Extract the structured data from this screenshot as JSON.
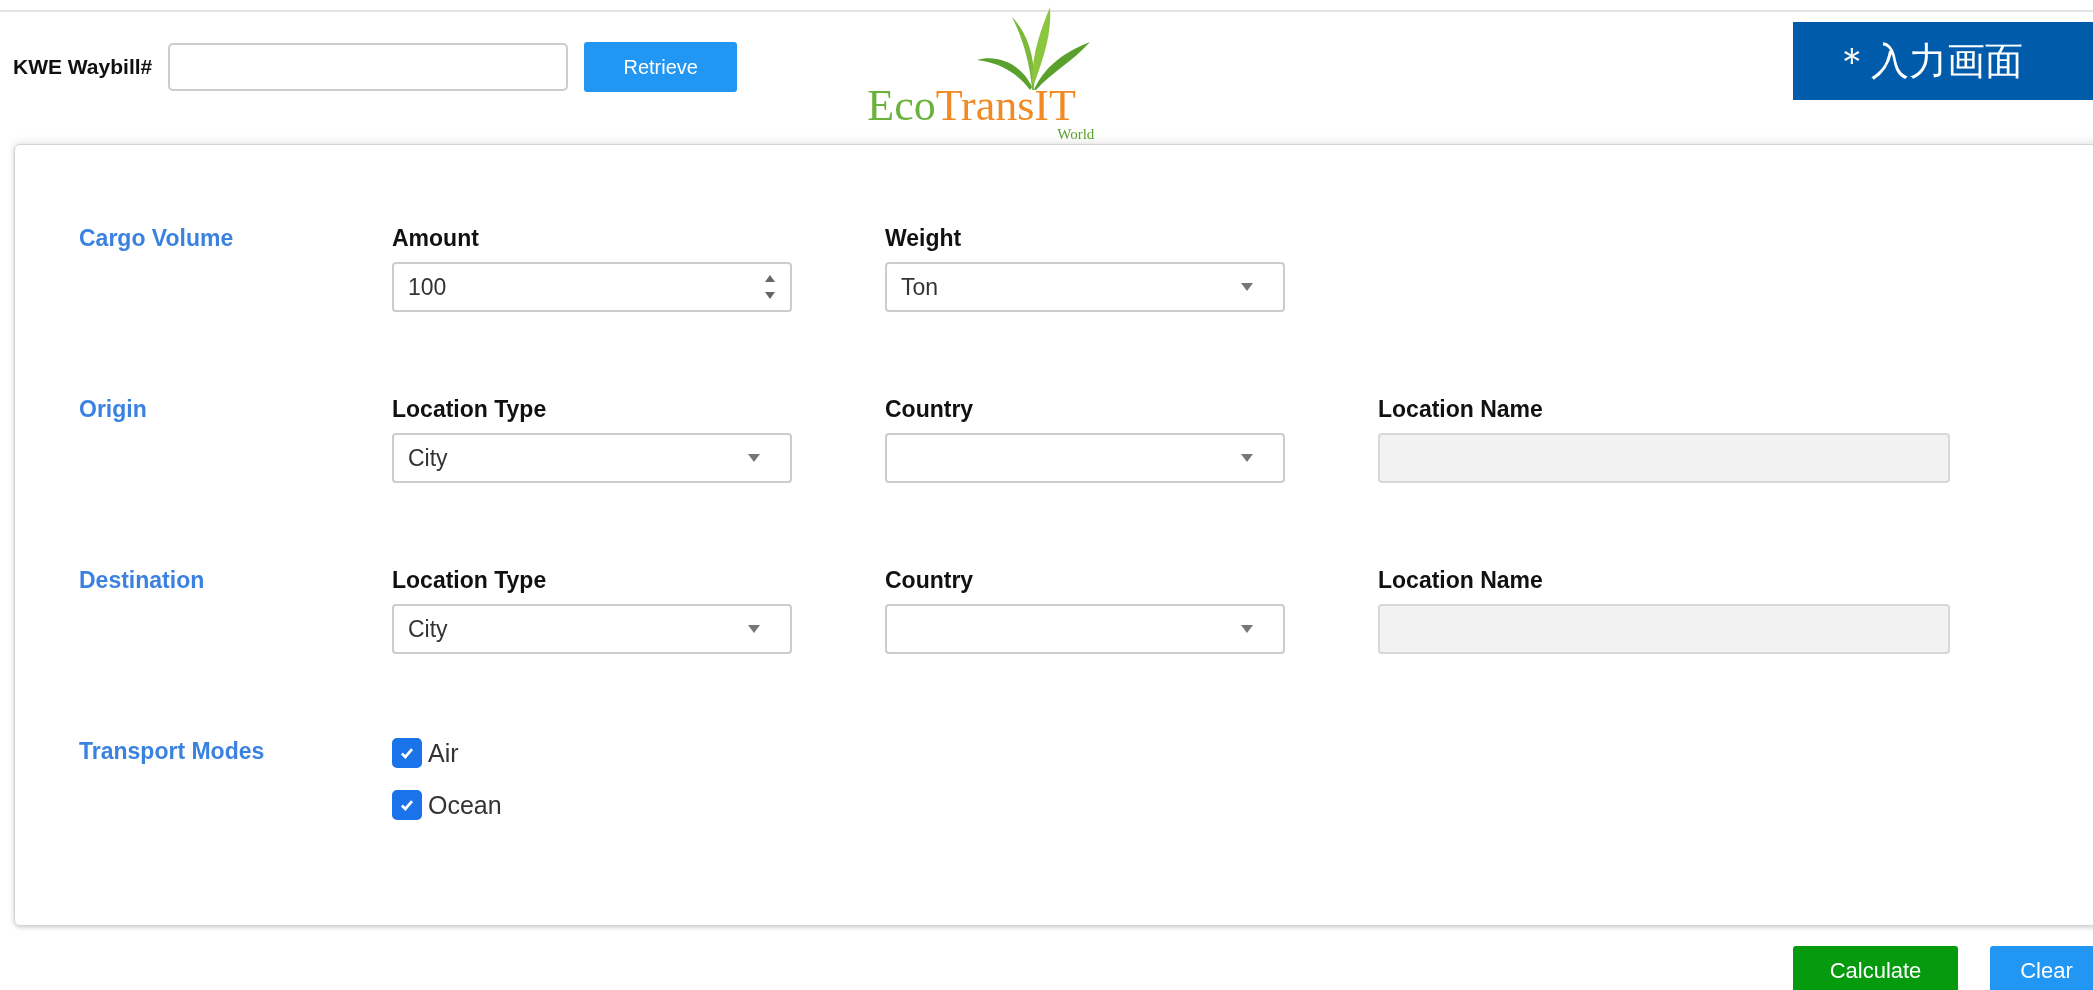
{
  "header": {
    "waybill_label": "KWE Waybill#",
    "retrieve_button": "Retrieve",
    "logo": {
      "eco": "Eco",
      "transit": "TransIT",
      "world": "World"
    },
    "badge": "＊入力画面"
  },
  "sections": [
    {
      "title": "Cargo Volume",
      "kind": "fields",
      "fields": [
        {
          "label": "Amount",
          "kind": "number",
          "value": "100",
          "disabled": false
        },
        {
          "label": "Weight",
          "kind": "select",
          "value": "Ton",
          "disabled": false
        }
      ]
    },
    {
      "title": "Origin",
      "kind": "fields",
      "fields": [
        {
          "label": "Location Type",
          "kind": "select",
          "value": "City",
          "disabled": false
        },
        {
          "label": "Country",
          "kind": "select",
          "disabled": false
        },
        {
          "label": "Location Name",
          "kind": "text",
          "disabled": true
        }
      ]
    },
    {
      "title": "Destination",
      "kind": "fields",
      "fields": [
        {
          "label": "Location Type",
          "kind": "select",
          "value": "City",
          "disabled": false
        },
        {
          "label": "Country",
          "kind": "select",
          "disabled": false
        },
        {
          "label": "Location Name",
          "kind": "text",
          "disabled": true
        }
      ]
    },
    {
      "title": "Transport Modes",
      "kind": "checkboxes",
      "options": [
        {
          "label": "Air",
          "checked": true
        },
        {
          "label": "Ocean",
          "checked": true
        }
      ]
    }
  ],
  "buttons": [
    {
      "label": "Calculate",
      "kind": "primary"
    },
    {
      "label": "Clear",
      "kind": "secondary"
    }
  ]
}
